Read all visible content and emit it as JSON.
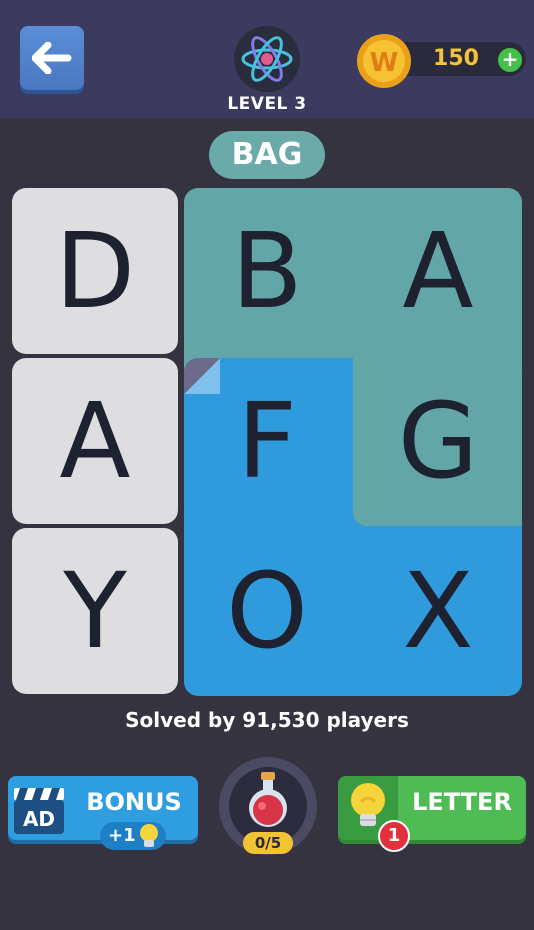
{
  "header": {
    "level_label": "LEVEL 3",
    "coins": "150",
    "coin_symbol": "W",
    "add_coins": "+"
  },
  "puzzle": {
    "word": "BAG",
    "grid": [
      [
        "D",
        "B",
        "A"
      ],
      [
        "A",
        "F",
        "G"
      ],
      [
        "Y",
        "O",
        "X"
      ]
    ],
    "solved_text": "Solved by 91,530 players"
  },
  "actions": {
    "bonus_label": "BONUS",
    "bonus_reward": "+1",
    "ad_label": "AD",
    "potion_count": "0/5",
    "letter_label": "LETTER",
    "letter_badge": "1"
  },
  "colors": {
    "header_bg": "#3c3a5f",
    "page_bg": "#34333f",
    "cell_gray": "#dedee0",
    "found_teal": "#63a6a7",
    "active_blue": "#309bdc",
    "bonus_blue": "#2f9ee0",
    "letter_green": "#4fbb54",
    "coin_gold": "#f4c338"
  }
}
